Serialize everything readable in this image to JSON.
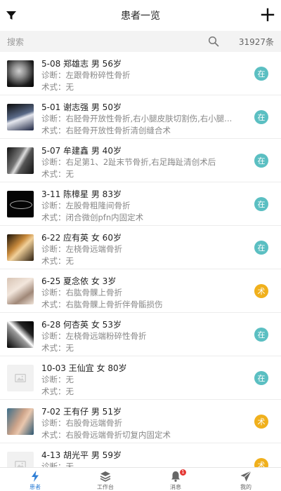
{
  "header": {
    "title": "患者一览"
  },
  "search": {
    "placeholder": "搜索",
    "count": "31927条"
  },
  "colors": {
    "in_hospital": "#5bbfc2",
    "surgery": "#f0b01c",
    "accent": "#2f7fd6"
  },
  "patients": [
    {
      "line1": "5-08 郑雄志  男  56岁",
      "diagnosis": "诊断：左跟骨粉碎性骨折",
      "surgery": "术式：无",
      "status": "在",
      "thumb": "xray"
    },
    {
      "line1": "5-01 谢志强  男  50岁",
      "diagnosis": "诊断：右胫骨开放性骨折,右小腿皮肤切割伤,右小腿...",
      "surgery": "术式：右胫骨开放性骨折清创缝合术",
      "status": "在",
      "thumb": "xray2"
    },
    {
      "line1": "5-07 牟建鑫  男  40岁",
      "diagnosis": "诊断：右足第1、2趾末节骨折,右足踇趾清创术后",
      "surgery": "术式：无",
      "status": "在",
      "thumb": "xray3"
    },
    {
      "line1": "3-11 陈樟星  男  83岁",
      "diagnosis": "诊断：左股骨粗隆间骨折",
      "surgery": "术式：闭合微创pfn内固定术",
      "status": "在",
      "thumb": "ct"
    },
    {
      "line1": "6-22 应有英  女  60岁",
      "diagnosis": "诊断：左桡骨远端骨折",
      "surgery": "术式：无",
      "status": "在",
      "thumb": "hand"
    },
    {
      "line1": "6-25 夏念依  女  3岁",
      "diagnosis": "诊断：右肱骨髁上骨折",
      "surgery": "术式：右肱骨髁上骨折伴骨骺损伤",
      "status": "术",
      "thumb": "photo"
    },
    {
      "line1": "6-28 何杏英  女  53岁",
      "diagnosis": "诊断：左桡骨远端粉碎性骨折",
      "surgery": "术式：无",
      "status": "在",
      "thumb": "xray4"
    },
    {
      "line1": "10-03 王仙宜  女  80岁",
      "diagnosis": "诊断：无",
      "surgery": "术式：无",
      "status": "在",
      "thumb": "placeholder"
    },
    {
      "line1": "7-02 王有仔  男  51岁",
      "diagnosis": "诊断：右股骨远端骨折",
      "surgery": "术式：右股骨远端骨折切复内固定术",
      "status": "术",
      "thumb": "arm"
    },
    {
      "line1": "4-13 胡光平  男  59岁",
      "diagnosis": "诊断：无",
      "surgery": "",
      "status": "术",
      "thumb": "placeholder"
    }
  ],
  "tabs": [
    {
      "label": "患者",
      "icon": "lightning-icon",
      "active": true
    },
    {
      "label": "工作台",
      "icon": "layers-icon",
      "active": false
    },
    {
      "label": "消息",
      "icon": "bell-icon",
      "active": false,
      "badge": "1"
    },
    {
      "label": "我的",
      "icon": "paper-plane-icon",
      "active": false
    }
  ]
}
